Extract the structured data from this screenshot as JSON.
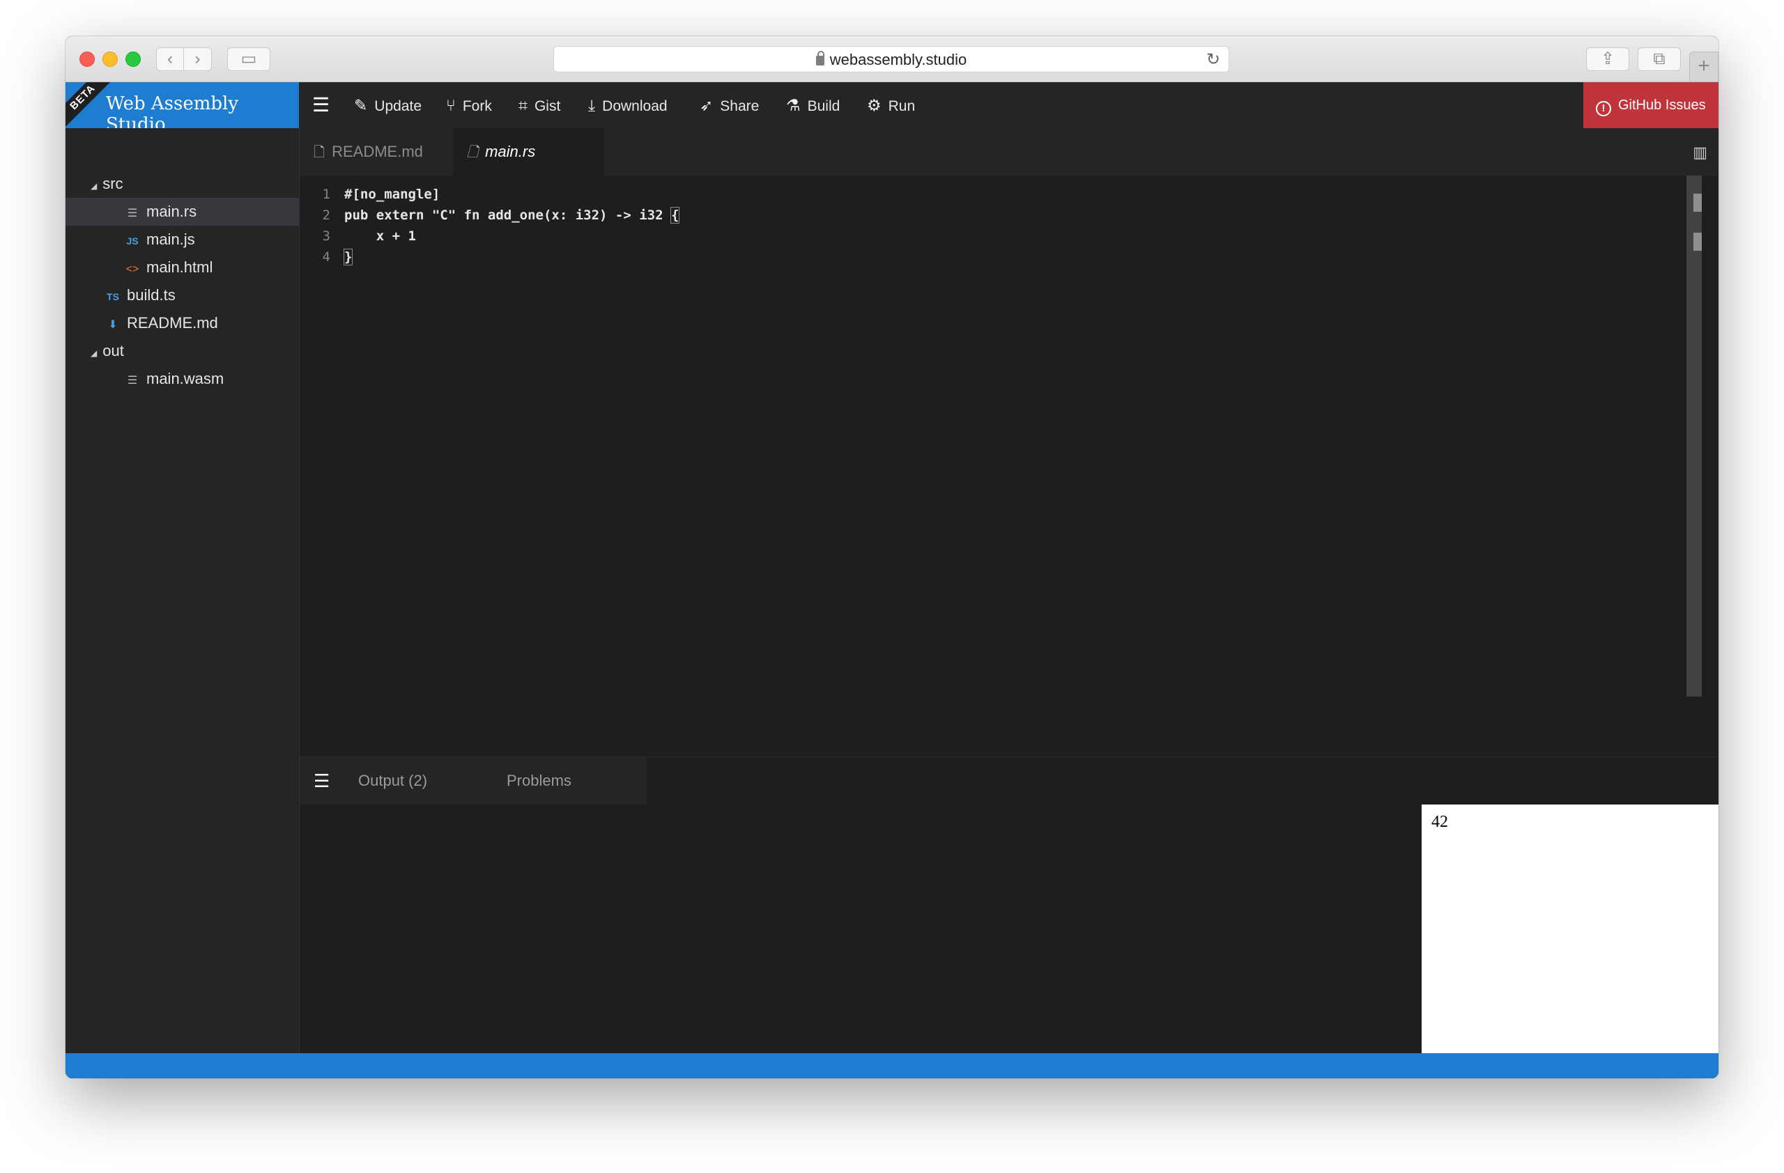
{
  "browser": {
    "url": "webassembly.studio"
  },
  "app": {
    "brand": "Web Assembly Studio",
    "beta_badge": "BETA",
    "toolbar": {
      "update": "Update",
      "fork": "Fork",
      "gist": "Gist",
      "download": "Download",
      "share": "Share",
      "build": "Build",
      "run": "Run",
      "github_issues": "GitHub Issues"
    },
    "icons": {
      "update": "✎",
      "fork": "⑂",
      "gist": "⌗",
      "download": "⤓",
      "share": "➶",
      "build": "⚗",
      "run": "⚙",
      "menu": "☰"
    },
    "accent_color": "#1e7dd0",
    "danger_color": "#c0353c"
  },
  "file_tree": {
    "items": [
      {
        "label": "src",
        "type": "folder"
      },
      {
        "label": "main.rs",
        "type": "file",
        "selected": true
      },
      {
        "label": "main.js",
        "type": "js"
      },
      {
        "label": "main.html",
        "type": "html"
      },
      {
        "label": "build.ts",
        "type": "ts"
      },
      {
        "label": "README.md",
        "type": "md"
      },
      {
        "label": "out",
        "type": "folder"
      },
      {
        "label": "main.wasm",
        "type": "file"
      }
    ]
  },
  "editor": {
    "tabs": [
      {
        "label": "README.md",
        "active": false
      },
      {
        "label": "main.rs",
        "active": true
      }
    ],
    "lines": [
      {
        "num": "1",
        "text": "#[no_mangle]"
      },
      {
        "num": "2",
        "text": "pub extern \"C\" fn add_one(x: i32) -> i32 "
      },
      {
        "num": "3",
        "text": "    x + 1"
      },
      {
        "num": "4",
        "text": ""
      }
    ],
    "open_brace": "{",
    "close_brace": "}"
  },
  "panel": {
    "tabs": {
      "output": "Output (2)",
      "problems": "Problems"
    },
    "preview_output": "42"
  }
}
